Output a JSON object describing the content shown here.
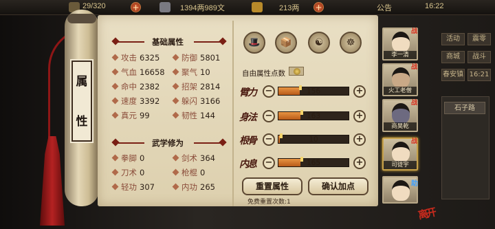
{
  "topbar": {
    "stamina": "29/320",
    "coins": "1394两989文",
    "gold": "213两",
    "notice": "公告",
    "clock": "16:22"
  },
  "side_menu": {
    "activity": "活动",
    "wish": "震零",
    "shop": "商城",
    "fight": "战斗",
    "location": "春安镇",
    "location_num": "16:21",
    "place": "石子路"
  },
  "scroll_title": [
    "属",
    "性"
  ],
  "basic": {
    "header": "基础属性",
    "stats": [
      {
        "name": "攻击",
        "value": "6325"
      },
      {
        "name": "防御",
        "value": "5801"
      },
      {
        "name": "气血",
        "value": "16658"
      },
      {
        "name": "聚气",
        "value": "10"
      },
      {
        "name": "命中",
        "value": "2382"
      },
      {
        "name": "招架",
        "value": "2814"
      },
      {
        "name": "速度",
        "value": "3392"
      },
      {
        "name": "躲闪",
        "value": "3166"
      },
      {
        "name": "真元",
        "value": "99"
      },
      {
        "name": "韧性",
        "value": "144"
      }
    ]
  },
  "martial": {
    "header": "武学修为",
    "stats": [
      {
        "name": "拳脚",
        "value": "0"
      },
      {
        "name": "剑术",
        "value": "364"
      },
      {
        "name": "刀术",
        "value": "0"
      },
      {
        "name": "枪棍",
        "value": "0"
      },
      {
        "name": "轻功",
        "value": "307"
      },
      {
        "name": "内功",
        "value": "265"
      }
    ]
  },
  "skill_icons": [
    "hat-icon",
    "treasure-icon",
    "taiji-icon",
    "meditation-icon"
  ],
  "free_points_label": "自由属性点数",
  "attributes": [
    {
      "name": "臂力",
      "value": 156,
      "fraction": 0.3
    },
    {
      "name": "身法",
      "value": 163,
      "fraction": 0.31
    },
    {
      "name": "根骨",
      "value": 10,
      "fraction": 0.02
    },
    {
      "name": "内息",
      "value": 165,
      "fraction": 0.31
    }
  ],
  "buttons": {
    "minus": "−",
    "plus": "+",
    "reset": "重置属性",
    "confirm": "确认加点",
    "reset_note": "免费重置次数:1",
    "leave": "离开"
  },
  "roster": [
    {
      "name": "李一清",
      "badge": "战"
    },
    {
      "name": "火工老僧",
      "badge": "战"
    },
    {
      "name": "商昊乾",
      "badge": "战"
    },
    {
      "name": "司徒宇",
      "badge": "战"
    },
    {
      "name": "",
      "badge": "助"
    }
  ],
  "colors": {
    "accent_red": "#7a1f14",
    "bar_fill": "#e89442",
    "paper": "#e9dfc4"
  }
}
